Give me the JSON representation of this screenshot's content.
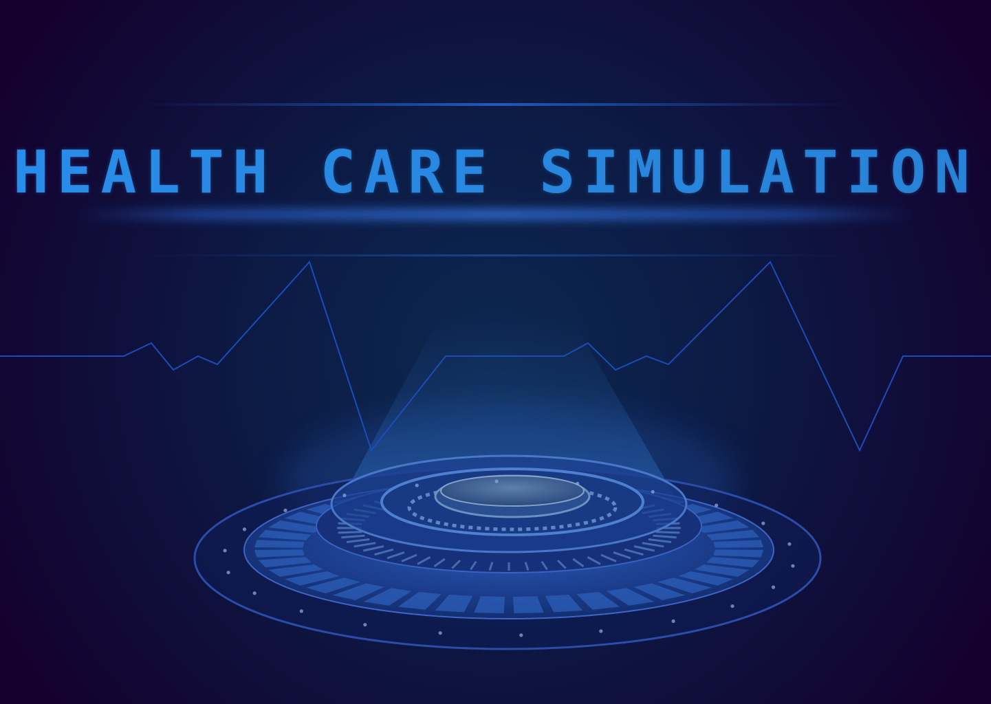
{
  "screen": {
    "title": "HEALTH CARE SIMULATION"
  },
  "colors": {
    "background_edge": "#14002e",
    "background_center": "#0c2048",
    "title_left": "#2a8de0",
    "title_right": "#2a7fc4",
    "heartbeat_line": "#1d4bb8",
    "platform_ring": "#3e66c8",
    "platform_fill": "#1a3c86",
    "platform_glow": "#5fa8ff",
    "halo_glow": "#2a6ad8"
  }
}
